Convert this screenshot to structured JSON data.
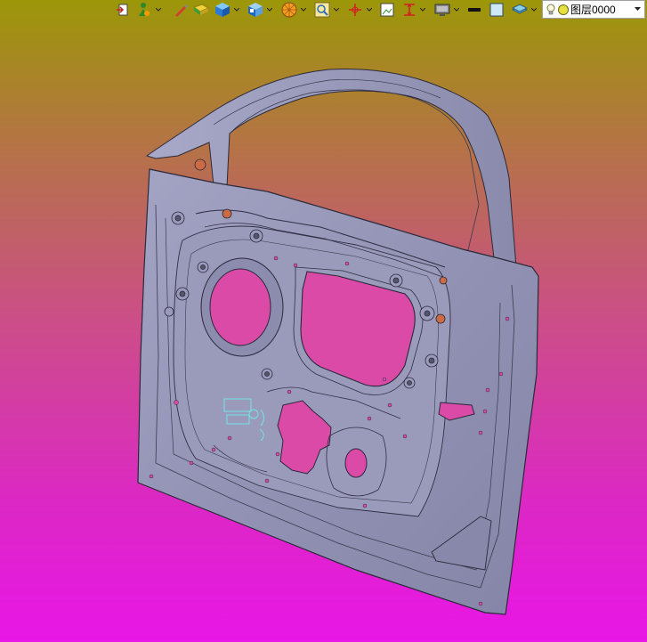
{
  "toolbar": {
    "tools": [
      {
        "icon": "open-file-icon"
      },
      {
        "icon": "person-tool-icon"
      },
      {
        "icon": "pencil-icon"
      },
      {
        "icon": "folder-yellow-icon"
      },
      {
        "icon": "cube-icon"
      },
      {
        "icon": "view-cube-icon"
      },
      {
        "icon": "color-wheel-icon"
      },
      {
        "icon": "zoom-fit-icon"
      },
      {
        "icon": "axis-icon"
      },
      {
        "icon": "image-icon"
      },
      {
        "icon": "measure-icon"
      },
      {
        "icon": "display-monitor-icon"
      },
      {
        "icon": "line-weight-icon"
      },
      {
        "icon": "box-outline-icon"
      },
      {
        "icon": "layers-icon"
      }
    ],
    "layer": {
      "bulb_icon": "bulb-icon",
      "color_icon": "yellow-circle-icon",
      "name": "图层0000"
    }
  },
  "model": {
    "name": "car-door-inner-panel",
    "surface_color": "#9494b6",
    "edge_color": "#2a2a3a",
    "hole_color": "#dc4aa8",
    "background_top": "#9c9708",
    "background_bottom": "#e816e6"
  }
}
